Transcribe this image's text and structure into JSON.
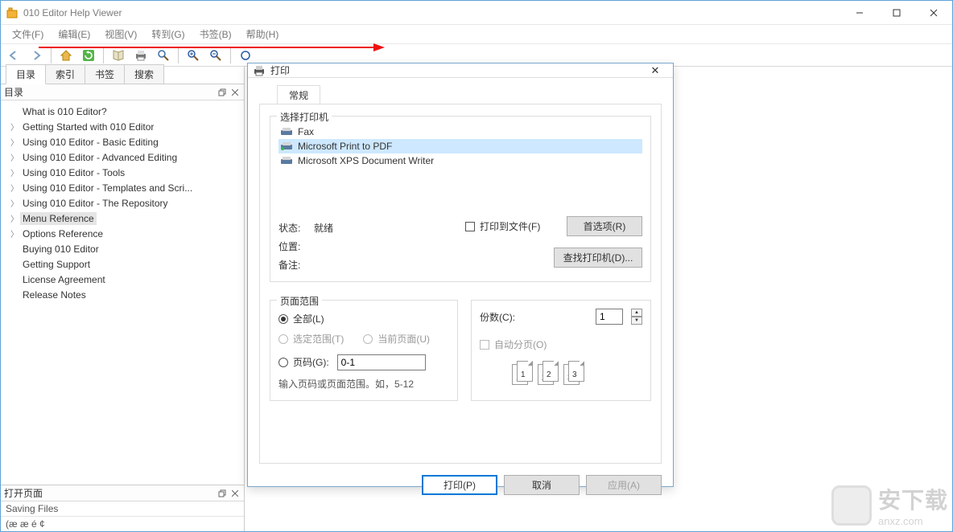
{
  "window": {
    "title": "010 Editor Help Viewer"
  },
  "menu": {
    "items": [
      "文件(F)",
      "编辑(E)",
      "视图(V)",
      "转到(G)",
      "书签(B)",
      "帮助(H)"
    ]
  },
  "sidebar": {
    "tabs": [
      "目录",
      "索引",
      "书签",
      "搜索"
    ],
    "panel_label": "目录",
    "tree": [
      {
        "label": "What is 010 Editor?",
        "exp": false
      },
      {
        "label": "Getting Started with 010 Editor",
        "exp": true
      },
      {
        "label": "Using 010 Editor - Basic Editing",
        "exp": true
      },
      {
        "label": "Using 010 Editor - Advanced Editing",
        "exp": true
      },
      {
        "label": "Using 010 Editor - Tools",
        "exp": true
      },
      {
        "label": "Using 010 Editor - Templates and Scri...",
        "exp": true
      },
      {
        "label": "Using 010 Editor - The Repository",
        "exp": true
      },
      {
        "label": "Menu Reference",
        "exp": true,
        "selected": true
      },
      {
        "label": "Options Reference",
        "exp": true
      },
      {
        "label": "Buying 010 Editor",
        "exp": false
      },
      {
        "label": "Getting Support",
        "exp": false
      },
      {
        "label": "License Agreement",
        "exp": false
      },
      {
        "label": "Release Notes",
        "exp": false
      }
    ],
    "bottom_panel_label": "打开页面",
    "bottom_line1": "Saving Files",
    "bottom_line2": "(æ æ é ¢"
  },
  "print": {
    "title": "打印",
    "tab": "常规",
    "group_printer": "选择打印机",
    "printers": [
      {
        "name": "Fax",
        "selected": false
      },
      {
        "name": "Microsoft Print to PDF",
        "selected": true
      },
      {
        "name": "Microsoft XPS Document Writer",
        "selected": false
      }
    ],
    "status_label": "状态:",
    "status_value": "就绪",
    "location_label": "位置:",
    "remark_label": "备注:",
    "print_to_file": "打印到文件(F)",
    "btn_prefs": "首选项(R)",
    "btn_find": "查找打印机(D)...",
    "group_range": "页面范围",
    "radio_all": "全部(L)",
    "radio_sel": "选定范围(T)",
    "radio_cur": "当前页面(U)",
    "radio_pages": "页码(G):",
    "pages_value": "0-1",
    "pages_hint": "输入页码或页面范围。如，5-12",
    "copies_label": "份数(C):",
    "copies_value": "1",
    "collate": "自动分页(O)",
    "btn_print": "打印(P)",
    "btn_cancel": "取消",
    "btn_apply": "应用(A)"
  },
  "watermark": {
    "text": "安下载",
    "domain": "anxz.com"
  }
}
